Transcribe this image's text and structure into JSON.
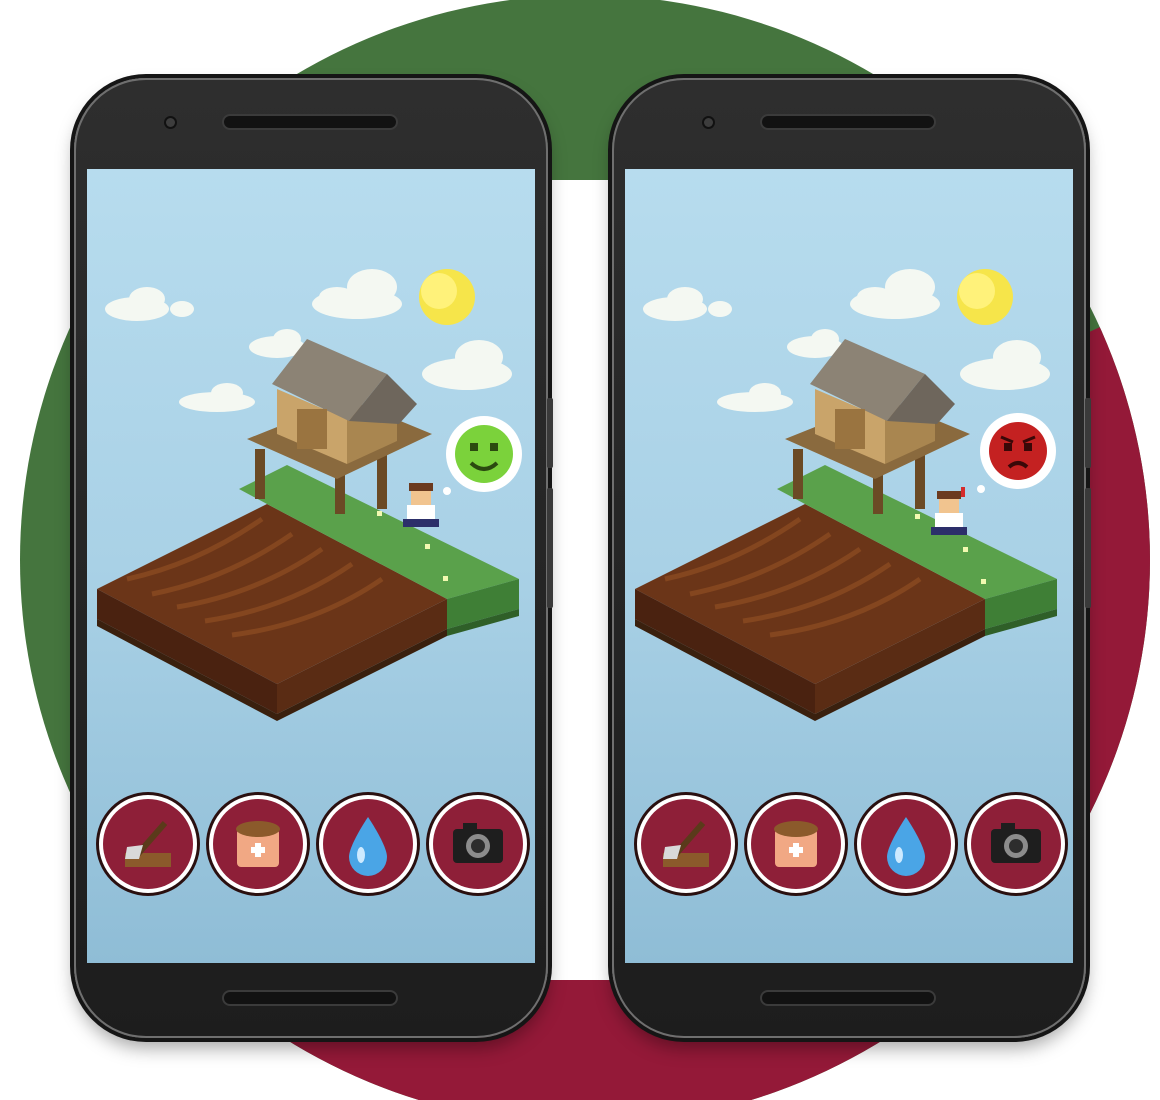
{
  "scene": {
    "background_circle_colors": [
      "#45753e",
      "#941938"
    ],
    "phones": [
      {
        "id": "left",
        "mood": "happy",
        "mood_icon": "happy-face-icon",
        "mood_color": "#7bd23b",
        "toolbar": [
          "hoe-icon",
          "seed-bag-icon",
          "water-drop-icon",
          "camera-icon"
        ]
      },
      {
        "id": "right",
        "mood": "angry",
        "mood_icon": "angry-face-icon",
        "mood_color": "#c42121",
        "toolbar": [
          "hoe-icon",
          "seed-bag-icon",
          "water-drop-icon",
          "camera-icon"
        ]
      }
    ]
  }
}
